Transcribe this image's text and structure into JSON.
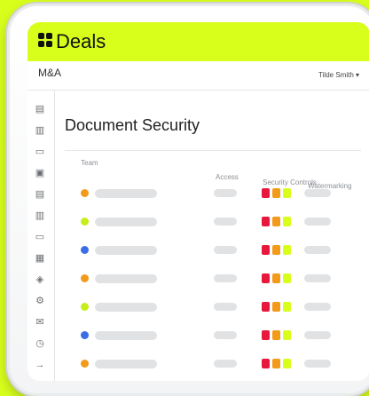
{
  "app": {
    "title": "Deals",
    "workspace": "M&A",
    "user_menu": "Tilde Smith ▾",
    "accent_color": "#d8ff1c"
  },
  "sidebar": {
    "items": [
      {
        "icon": "document-icon",
        "glyph": "▤"
      },
      {
        "icon": "folder-icon",
        "glyph": "▥"
      },
      {
        "icon": "file-icon",
        "glyph": "▭"
      },
      {
        "icon": "image-icon",
        "glyph": "▣"
      },
      {
        "icon": "list-icon",
        "glyph": "▤"
      },
      {
        "icon": "binder-icon",
        "glyph": "▥"
      },
      {
        "icon": "page-icon",
        "glyph": "▭"
      },
      {
        "icon": "archive-icon",
        "glyph": "▦"
      },
      {
        "icon": "shield-icon",
        "glyph": "◈"
      },
      {
        "icon": "gear-icon",
        "glyph": "⚙"
      },
      {
        "icon": "mail-icon",
        "glyph": "✉"
      },
      {
        "icon": "clock-icon",
        "glyph": "◷"
      },
      {
        "icon": "arrow-right-icon",
        "glyph": "→"
      }
    ]
  },
  "page": {
    "title": "Document Security",
    "columns": {
      "team": "Team",
      "access": "Access",
      "security": "Security Controls",
      "watermark": "Watermarking"
    }
  },
  "rows": [
    {
      "dot": "#f39a1a",
      "controls": [
        "#e8183c",
        "#f39a1a",
        "#d8ff1c"
      ]
    },
    {
      "dot": "#c6ee1a",
      "controls": [
        "#e8183c",
        "#f39a1a",
        "#d8ff1c"
      ]
    },
    {
      "dot": "#3b6ee6",
      "controls": [
        "#e8183c",
        "#f39a1a",
        "#d8ff1c"
      ]
    },
    {
      "dot": "#f39a1a",
      "controls": [
        "#e8183c",
        "#f39a1a",
        "#d8ff1c"
      ]
    },
    {
      "dot": "#c6ee1a",
      "controls": [
        "#e8183c",
        "#f39a1a",
        "#d8ff1c"
      ]
    },
    {
      "dot": "#3b6ee6",
      "controls": [
        "#e8183c",
        "#f39a1a",
        "#d8ff1c"
      ]
    },
    {
      "dot": "#f39a1a",
      "controls": [
        "#e8183c",
        "#f39a1a",
        "#d8ff1c"
      ]
    }
  ]
}
